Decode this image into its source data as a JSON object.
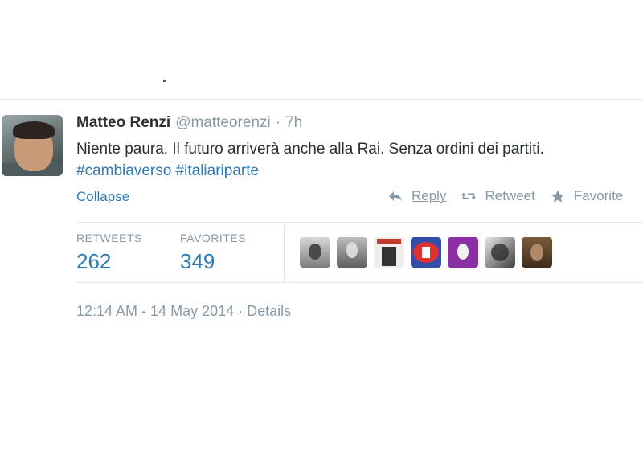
{
  "tweet": {
    "name": "Matteo Renzi",
    "handle": "@matteorenzi",
    "separator": "·",
    "age": "7h",
    "text": "Niente paura. Il futuro arriverà anche alla Rai. Senza ordini dei partiti.",
    "hashtags": [
      "#cambiaverso",
      "#italiariparte"
    ]
  },
  "controls": {
    "collapse": "Collapse",
    "reply": "Reply",
    "retweet": "Retweet",
    "favorite": "Favorite"
  },
  "stats": {
    "retweets_label": "RETWEETS",
    "retweets_count": "262",
    "favorites_label": "FAVORITES",
    "favorites_count": "349"
  },
  "favoriters": [
    "user-1",
    "user-2",
    "user-3",
    "user-4",
    "user-5",
    "user-6",
    "user-7"
  ],
  "footer": {
    "timestamp": "12:14 AM - 14 May 2014",
    "separator": "·",
    "details": "Details"
  },
  "colors": {
    "link": "#2b7bb9",
    "muted": "#8899a6",
    "text": "#292f33",
    "rule": "#e1e8ed"
  }
}
